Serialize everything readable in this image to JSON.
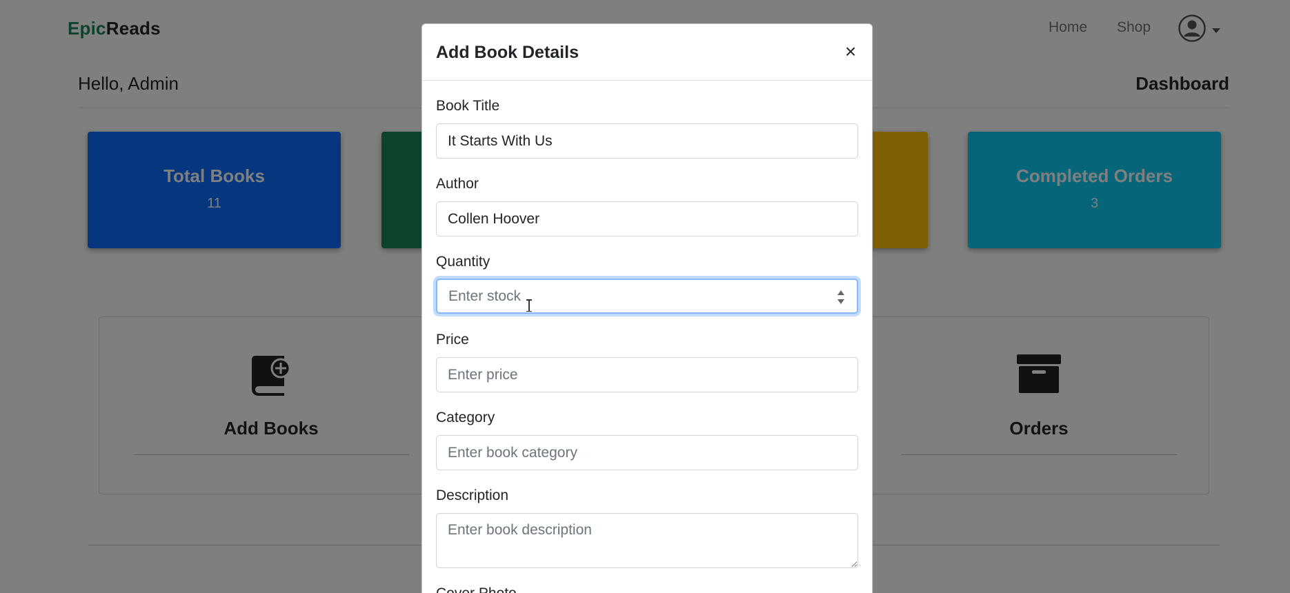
{
  "navbar": {
    "brand_part1": "Epic",
    "brand_part2": "Reads",
    "links": [
      "Home",
      "Shop"
    ],
    "user_menu_icon": "user-circle-icon"
  },
  "header": {
    "greeting": "Hello, Admin",
    "title": "Dashboard"
  },
  "stats": [
    {
      "label": "Total Books",
      "value": "11",
      "color": "#0d6efd"
    },
    {
      "label": "",
      "value": "",
      "color": "#198754"
    },
    {
      "label": "",
      "value": "",
      "color": "#ffc107"
    },
    {
      "label": "Completed Orders",
      "value": "3",
      "color": "#0dcaf0"
    }
  ],
  "actions": [
    {
      "label": "Add Books",
      "icon": "book-plus-icon"
    },
    {
      "label": "Orders",
      "icon": "archive-box-icon"
    }
  ],
  "modal": {
    "title": "Add Book Details",
    "close_label": "×",
    "fields": [
      {
        "label": "Book Title",
        "value": "It Starts With Us",
        "placeholder": ""
      },
      {
        "label": "Author",
        "value": "Collen Hoover",
        "placeholder": ""
      },
      {
        "label": "Quantity",
        "value": "",
        "placeholder": "Enter stock"
      },
      {
        "label": "Price",
        "value": "",
        "placeholder": "Enter price"
      },
      {
        "label": "Category",
        "value": "",
        "placeholder": "Enter book category"
      },
      {
        "label": "Description",
        "value": "",
        "placeholder": "Enter book description"
      },
      {
        "label": "Cover Photo"
      }
    ]
  },
  "colors": {
    "brand_accent": "#198754",
    "focus_border": "#86b7fe"
  }
}
